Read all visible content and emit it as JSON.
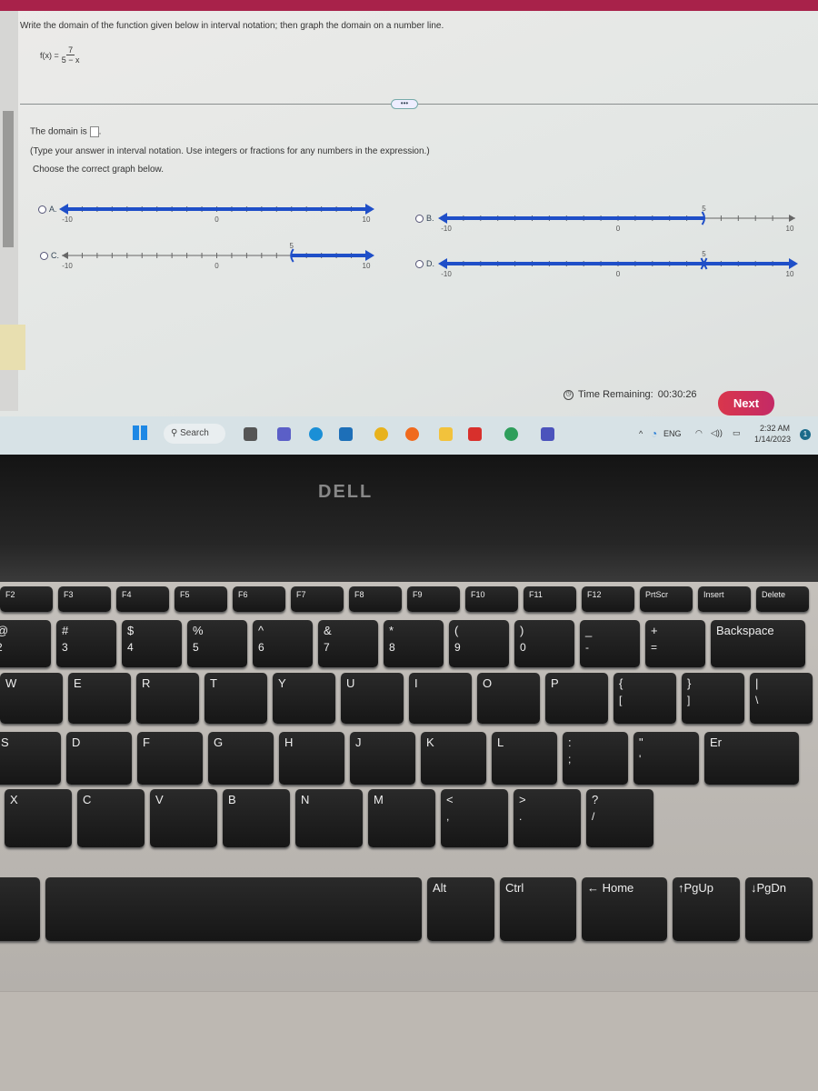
{
  "question": {
    "prompt": "Write the domain of the function given below in interval notation; then graph the domain on a number line.",
    "function_lhs": "f(x) =",
    "numerator": "7",
    "denominator": "5 − x",
    "more_label": "•••",
    "domain_prefix": "The domain is",
    "domain_value": "",
    "domain_suffix": ".",
    "instruction": "(Type your answer in interval notation. Use integers or fractions for any numbers in the expression.)",
    "choose": "Choose the correct graph below."
  },
  "options": [
    {
      "letter": "A.",
      "shading": "all real numbers",
      "labels": [
        "-10",
        "0",
        "10"
      ],
      "selected": false
    },
    {
      "letter": "B.",
      "shading": "x < 5",
      "labels": [
        "-10",
        "0",
        "10",
        "5"
      ],
      "selected": false
    },
    {
      "letter": "C.",
      "shading": "x > 5",
      "labels": [
        "-10",
        "0",
        "10",
        "5"
      ],
      "selected": false
    },
    {
      "letter": "D.",
      "shading": "x ≠ 5",
      "labels": [
        "-10",
        "0",
        "10",
        "5"
      ],
      "selected": false
    }
  ],
  "footer": {
    "timer_label": "Time Remaining:",
    "timer_value": "00:30:26",
    "next_label": "Next"
  },
  "taskbar": {
    "search": "Search",
    "lang": "ENG",
    "time": "2:32 AM",
    "date": "1/14/2023",
    "badge": "1",
    "apps": [
      "file-explorer-icon",
      "teams-meet-icon",
      "edge-icon",
      "store-icon",
      "chrome-icon",
      "firefox-icon",
      "folder-icon",
      "wps-icon",
      "edge-dev-icon",
      "teams-icon"
    ]
  },
  "colors": {
    "accent": "#1f4fc8",
    "brand_bar": "#a8224a",
    "next": "#d13354"
  },
  "laptop": {
    "brand": "DELL"
  },
  "keyboard": {
    "fn_row": [
      "F2",
      "F3",
      "F4",
      "F5",
      "F6",
      "F7",
      "F8",
      "F9",
      "F10",
      "F11",
      "F12",
      "PrtScr",
      "Insert",
      "Delete"
    ],
    "number_row": [
      [
        "@",
        "2"
      ],
      [
        "#",
        "3"
      ],
      [
        "$",
        "4"
      ],
      [
        "%",
        "5"
      ],
      [
        "^",
        "6"
      ],
      [
        "&",
        "7"
      ],
      [
        "*",
        "8"
      ],
      [
        "(",
        "9"
      ],
      [
        ")",
        "0"
      ],
      [
        "_",
        "-"
      ],
      [
        "+",
        "="
      ],
      [
        "Backspace",
        ""
      ]
    ],
    "top_row": [
      [
        "W",
        ""
      ],
      [
        "E",
        ""
      ],
      [
        "R",
        ""
      ],
      [
        "T",
        ""
      ],
      [
        "Y",
        ""
      ],
      [
        "U",
        ""
      ],
      [
        "I",
        ""
      ],
      [
        "O",
        ""
      ],
      [
        "P",
        ""
      ],
      [
        "{",
        "["
      ],
      [
        "}",
        "]"
      ],
      [
        "|",
        "\\"
      ]
    ],
    "home_row": [
      [
        "S",
        ""
      ],
      [
        "D",
        ""
      ],
      [
        "F",
        ""
      ],
      [
        "G",
        ""
      ],
      [
        "H",
        ""
      ],
      [
        "J",
        ""
      ],
      [
        "K",
        ""
      ],
      [
        "L",
        ""
      ],
      [
        ":",
        ";"
      ],
      [
        "\"",
        "'"
      ],
      [
        "Er",
        ""
      ]
    ],
    "bottom_row": [
      [
        "X",
        ""
      ],
      [
        "C",
        ""
      ],
      [
        "V",
        ""
      ],
      [
        "B",
        ""
      ],
      [
        "N",
        ""
      ],
      [
        "M",
        ""
      ],
      [
        "<",
        ","
      ],
      [
        ">",
        "."
      ],
      [
        "?",
        "/"
      ]
    ],
    "space_row": [
      [
        "Alt",
        ""
      ],
      [
        "",
        ""
      ],
      [
        "Alt",
        ""
      ],
      [
        "Ctrl",
        ""
      ],
      [
        "← Home",
        ""
      ],
      [
        "↑PgUp",
        ""
      ],
      [
        "↓PgDn",
        ""
      ]
    ]
  }
}
